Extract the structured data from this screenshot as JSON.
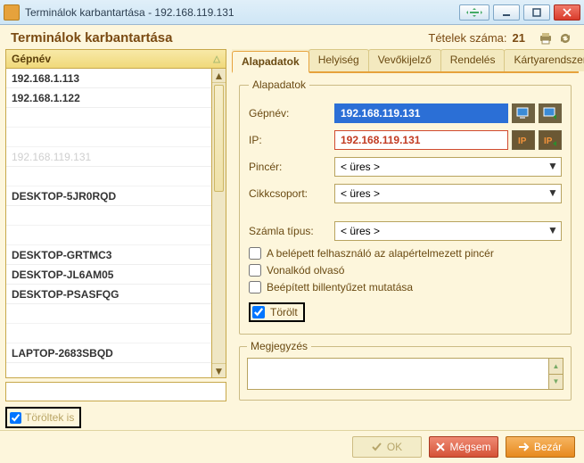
{
  "window": {
    "title": "Terminálok karbantartása - 192.168.119.131"
  },
  "header": {
    "page_title": "Terminálok karbantartása",
    "count_label": "Tételek száma:",
    "count_value": "21"
  },
  "sidebar": {
    "column_header": "Gépnév",
    "rows": [
      {
        "label": "192.168.1.113",
        "muted": false
      },
      {
        "label": "192.168.1.122",
        "muted": false
      },
      {
        "label": "",
        "muted": false
      },
      {
        "label": "",
        "muted": false
      },
      {
        "label": "192.168.119.131",
        "muted": true
      },
      {
        "label": "",
        "muted": false
      },
      {
        "label": "DESKTOP-5JR0RQD",
        "muted": false
      },
      {
        "label": "",
        "muted": false
      },
      {
        "label": "",
        "muted": false
      },
      {
        "label": "DESKTOP-GRTMC3",
        "muted": false
      },
      {
        "label": "DESKTOP-JL6AM05",
        "muted": false
      },
      {
        "label": "DESKTOP-PSASFQG",
        "muted": false
      },
      {
        "label": "",
        "muted": false
      },
      {
        "label": "",
        "muted": false
      },
      {
        "label": "LAPTOP-2683SBQD",
        "muted": false
      }
    ],
    "footer_checkbox_label": "Töröltek is"
  },
  "tabs": [
    {
      "id": "alapadatok",
      "label": "Alapadatok",
      "active": true
    },
    {
      "id": "helyiseg",
      "label": "Helyiség",
      "active": false
    },
    {
      "id": "vevokijelzo",
      "label": "Vevőkijelző",
      "active": false
    },
    {
      "id": "rendeles",
      "label": "Rendelés",
      "active": false
    },
    {
      "id": "kartyarendszer",
      "label": "Kártyarendszer",
      "active": false
    }
  ],
  "form": {
    "legend": "Alapadatok",
    "gepnev": {
      "label": "Gépnév:",
      "value": "192.168.119.131"
    },
    "ip": {
      "label": "IP:",
      "value": "192.168.119.131"
    },
    "pincer": {
      "label": "Pincér:",
      "value": "< üres >"
    },
    "cikkcsoport": {
      "label": "Cikkcsoport:",
      "value": "< üres >"
    },
    "szamlatipus": {
      "label": "Számla típus:",
      "value": "< üres >"
    },
    "chk_default_pincer": "A belépett felhasználó az alapértelmezett pincér",
    "chk_barcode": "Vonalkód olvasó",
    "chk_keyboard": "Beépített billentyűzet mutatása",
    "chk_deleted": "Törölt",
    "megjegyzes_legend": "Megjegyzés"
  },
  "footer": {
    "ok": "OK",
    "cancel": "Mégsem",
    "close": "Bezár"
  }
}
